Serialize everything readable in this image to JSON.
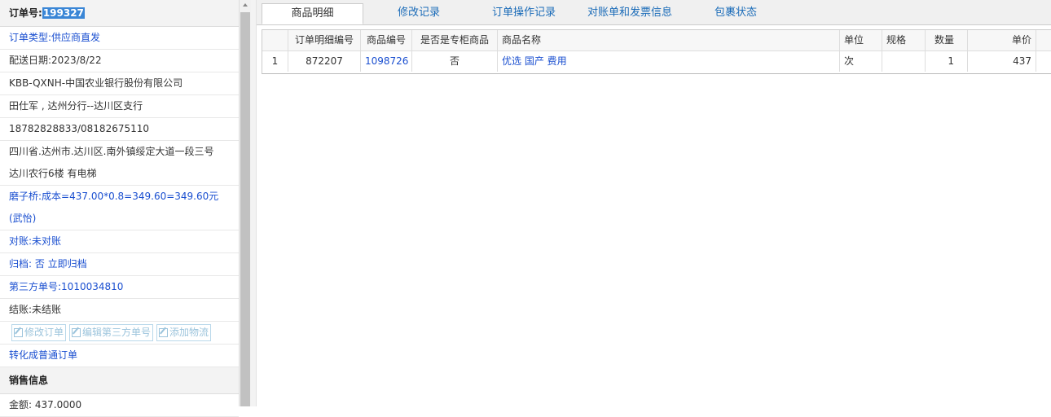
{
  "order": {
    "number_label": "订单号:",
    "number_value": "199327",
    "type": "订单类型:供应商直发",
    "delivery_date": "配送日期:2023/8/22",
    "customer": "KBB-QXNH-中国农业银行股份有限公司",
    "contact": "田仕军 , 达州分行--达川区支行",
    "phone": "18782828833/08182675110",
    "address_line1": "四川省.达州市.达川区.南外镇绥定大道一段三号",
    "address_line2": "达川农行6楼 有电梯",
    "note_line1": "磨子桥:成本=437.00*0.8=349.60=349.60元",
    "note_line2": "(武怡)",
    "reconcile": "对账:未对账",
    "archive": "归档: 否 立即归档",
    "third_party_no": "第三方单号:1010034810",
    "settle": "结账:未结账",
    "convert_link": "转化成普通订单"
  },
  "buttons": {
    "edit_order": "修改订单",
    "edit_third_party": "编辑第三方单号",
    "add_logistics": "添加物流"
  },
  "sales": {
    "section_title": "销售信息",
    "amount": "金额: 437.0000"
  },
  "tabs": [
    {
      "label": "商品明细"
    },
    {
      "label": "修改记录"
    },
    {
      "label": "订单操作记录"
    },
    {
      "label": "对账单和发票信息"
    },
    {
      "label": "包裹状态"
    }
  ],
  "table": {
    "headers": [
      "",
      "订单明细编号",
      "商品编号",
      "是否是专柜商品",
      "商品名称",
      "单位",
      "规格",
      "数量",
      "单价"
    ],
    "rows": [
      [
        "1",
        "872207",
        "1098726",
        "否",
        "优选 国产 费用",
        "次",
        "",
        "1",
        "437"
      ]
    ]
  },
  "colors": {
    "link": "#1a4fd0",
    "selection": "#3a86d6",
    "tab_text": "#1a6bb8"
  }
}
